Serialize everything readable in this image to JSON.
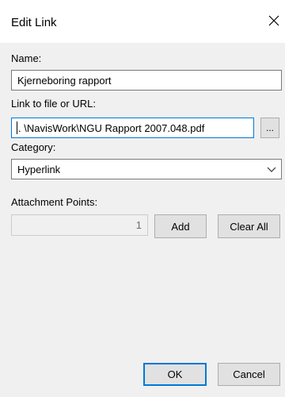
{
  "dialog": {
    "title": "Edit Link",
    "name_label": "Name:",
    "name_value": "Kjerneboring rapport",
    "link_label": "Link to file or URL:",
    "link_value": ". \\NavisWork\\NGU Rapport 2007.048.pdf",
    "browse_label": "...",
    "category_label": "Category:",
    "category_value": "Hyperlink",
    "attachment_label": "Attachment Points:",
    "attachment_count": "1",
    "add_label": "Add",
    "clear_all_label": "Clear All",
    "ok_label": "OK",
    "cancel_label": "Cancel"
  },
  "icons": {
    "close": "close-icon",
    "dropdown": "chevron-down-icon"
  },
  "colors": {
    "focus_border": "#0078d7",
    "button_face": "#e1e1e1",
    "window_bg": "#f0f0f0"
  }
}
